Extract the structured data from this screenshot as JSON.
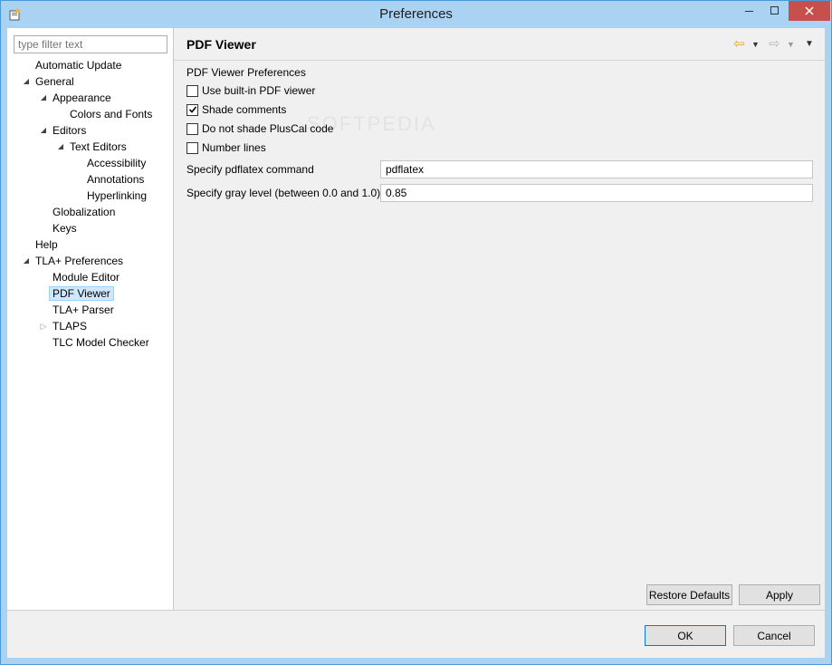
{
  "window": {
    "title": "Preferences"
  },
  "filter": {
    "placeholder": "type filter text"
  },
  "tree": [
    {
      "label": "Automatic Update",
      "twisty": ""
    },
    {
      "label": "General",
      "twisty": "open"
    },
    {
      "label": "Appearance",
      "twisty": "open"
    },
    {
      "label": "Colors and Fonts",
      "twisty": ""
    },
    {
      "label": "Editors",
      "twisty": "open"
    },
    {
      "label": "Text Editors",
      "twisty": "open"
    },
    {
      "label": "Accessibility",
      "twisty": ""
    },
    {
      "label": "Annotations",
      "twisty": ""
    },
    {
      "label": "Hyperlinking",
      "twisty": ""
    },
    {
      "label": "Globalization",
      "twisty": ""
    },
    {
      "label": "Keys",
      "twisty": ""
    },
    {
      "label": "Help",
      "twisty": ""
    },
    {
      "label": "TLA+ Preferences",
      "twisty": "open"
    },
    {
      "label": "Module Editor",
      "twisty": ""
    },
    {
      "label": "PDF Viewer",
      "twisty": "",
      "selected": true
    },
    {
      "label": "TLA+ Parser",
      "twisty": ""
    },
    {
      "label": "TLAPS",
      "twisty": "closed"
    },
    {
      "label": "TLC Model Checker",
      "twisty": ""
    }
  ],
  "page": {
    "title": "PDF Viewer",
    "group_label": "PDF Viewer Preferences",
    "checkboxes": [
      {
        "label": "Use built-in PDF viewer",
        "checked": false
      },
      {
        "label": "Shade comments",
        "checked": true
      },
      {
        "label": "Do not shade PlusCal code",
        "checked": false
      },
      {
        "label": "Number lines",
        "checked": false
      }
    ],
    "pdflatex_label": "Specify pdflatex command",
    "pdflatex_value": "pdflatex",
    "gray_label": "Specify gray level (between 0.0 and 1.0)",
    "gray_value": "0.85",
    "restore_label": "Restore Defaults",
    "apply_label": "Apply"
  },
  "footer": {
    "ok_label": "OK",
    "cancel_label": "Cancel"
  },
  "icons": {
    "back": "back-arrow-icon",
    "forward": "forward-arrow-icon",
    "menu": "view-menu-icon",
    "app": "app-icon"
  },
  "watermark": "SOFTPEDIA",
  "colors": {
    "titlebar": "#a9d2f3",
    "close": "#c7504d",
    "selection": "#cde8ff",
    "accent": "#0078d7"
  }
}
